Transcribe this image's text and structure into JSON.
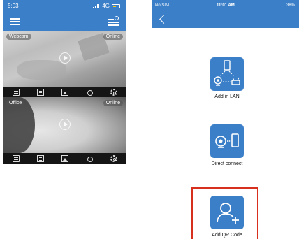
{
  "left_phone": {
    "status_time": "5:03",
    "status_network": "4G",
    "cameras": [
      {
        "name": "Webcam",
        "status": "Online"
      },
      {
        "name": "Office",
        "status": "Online"
      }
    ],
    "toolbar_icons": [
      "calendar-icon",
      "document-icon",
      "image-icon",
      "weather-icon",
      "settings-icon"
    ]
  },
  "right_phone": {
    "status_carrier": "No SIM",
    "status_time": "11:01 AM",
    "status_battery": "38%",
    "options": [
      {
        "label": "Add in LAN",
        "icon": "lan-icon"
      },
      {
        "label": "Direct connect",
        "icon": "direct-connect-icon"
      },
      {
        "label": "Add QR Code",
        "icon": "add-user-icon"
      }
    ],
    "highlight_color": "#d8301f",
    "accent_color": "#3b7fc8"
  }
}
